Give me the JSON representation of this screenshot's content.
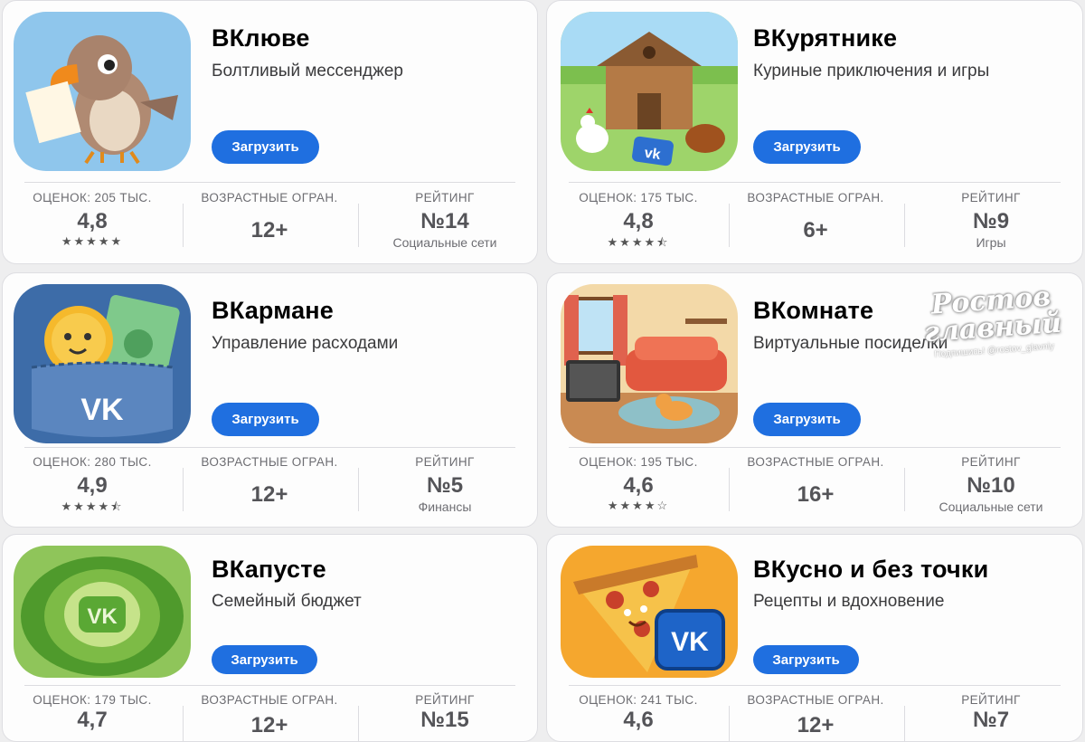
{
  "download_label": "Загрузить",
  "labels": {
    "ratings": "ОЦЕНОК",
    "age": "ВОЗРАСТНЫЕ ОГРАН.",
    "rank": "РЕЙТИНГ"
  },
  "apps": [
    {
      "title": "ВКлюве",
      "subtitle": "Болтливый мессенджер",
      "ratings_count": "ОЦЕНОК: 205 ТЫС.",
      "rating": "4,8",
      "stars": "★★★★★",
      "age": "12+",
      "rank": "№14",
      "category": "Социальные сети"
    },
    {
      "title": "ВКурятнике",
      "subtitle": "Куриные приключения и игры",
      "ratings_count": "ОЦЕНОК: 175 ТЫС.",
      "rating": "4,8",
      "stars": "★★★★⯪",
      "age": "6+",
      "rank": "№9",
      "category": "Игры"
    },
    {
      "title": "ВКармане",
      "subtitle": "Управление расходами",
      "ratings_count": "ОЦЕНОК: 280 ТЫС.",
      "rating": "4,9",
      "stars": "★★★★⯪",
      "age": "12+",
      "rank": "№5",
      "category": "Финансы"
    },
    {
      "title": "ВКомнате",
      "subtitle": "Виртуальные посиделки",
      "ratings_count": "ОЦЕНОК: 195 ТЫС.",
      "rating": "4,6",
      "stars": "★★★★☆",
      "age": "16+",
      "rank": "№10",
      "category": "Социальные сети"
    },
    {
      "title": "ВКапусте",
      "subtitle": "Семейный бюджет",
      "ratings_count": "ОЦЕНОК: 179 ТЫС.",
      "rating": "4,7",
      "stars": "",
      "age": "12+",
      "rank": "№15",
      "category": ""
    },
    {
      "title": "ВКусно и без точки",
      "subtitle": "Рецепты и вдохновение",
      "ratings_count": "ОЦЕНОК: 241 ТЫС.",
      "rating": "4,6",
      "stars": "",
      "age": "12+",
      "rank": "№7",
      "category": ""
    }
  ],
  "watermark": {
    "line1": "Ростов",
    "line2": "главный",
    "sub": "Подпишись! @rostov_glavniy"
  },
  "icon_names": [
    "parrot-icon",
    "chicken-coop-icon",
    "pocket-coin-icon",
    "room-cat-icon",
    "cabbage-icon",
    "pizza-icon"
  ]
}
